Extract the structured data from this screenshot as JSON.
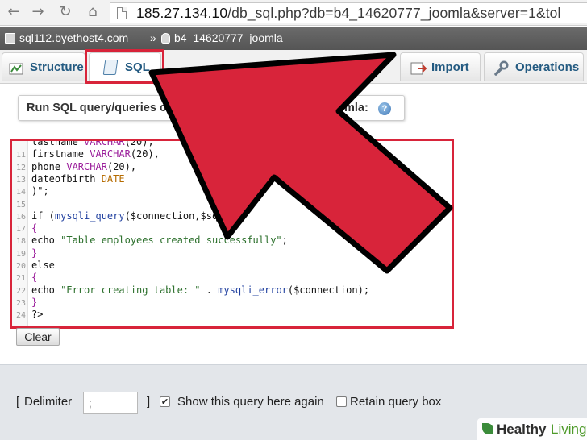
{
  "browser": {
    "url_host": "185.27.134.10",
    "url_path": "/db_sql.php?db=b4_14620777_joomla&server=1&tol"
  },
  "breadcrumb": {
    "server": "sql112.byethost4.com",
    "separator": "»",
    "database": "b4_14620777_joomla"
  },
  "tabs": [
    {
      "label": "Structure",
      "icon": "structure-icon"
    },
    {
      "label": "SQL",
      "icon": "sql-icon",
      "active": true
    },
    {
      "label": "Import",
      "icon": "import-icon"
    },
    {
      "label": "Operations",
      "icon": "wrench-icon"
    }
  ],
  "query_box": {
    "legend_left": "Run SQL query/queries on",
    "legend_right": "mla:",
    "help_icon": "help-icon",
    "code_lines": [
      {
        "n": "",
        "text": "lastname VARCHAR(20),"
      },
      {
        "n": "11",
        "text": "firstname VARCHAR(20),"
      },
      {
        "n": "12",
        "text": "phone VARCHAR(20),"
      },
      {
        "n": "13",
        "text": "dateofbirth DATE"
      },
      {
        "n": "14",
        "text": ")\";"
      },
      {
        "n": "15",
        "text": ""
      },
      {
        "n": "16",
        "text": "if (mysqli_query($connection,$sql))"
      },
      {
        "n": "17",
        "text": "{"
      },
      {
        "n": "18",
        "text": "echo \"Table employees created successfully\";"
      },
      {
        "n": "19",
        "text": "}"
      },
      {
        "n": "20",
        "text": "else"
      },
      {
        "n": "21",
        "text": "{"
      },
      {
        "n": "22",
        "text": "echo \"Error creating table: \" . mysqli_error($connection);"
      },
      {
        "n": "23",
        "text": "}"
      },
      {
        "n": "24",
        "text": "?>"
      }
    ],
    "clear_label": "Clear"
  },
  "options": {
    "open_bracket": "[",
    "delimiter_label": "Delimiter",
    "delimiter_value": ";",
    "close_bracket": "]",
    "show_query_label": "Show this query here again",
    "show_query_checked": true,
    "retain_label": "Retain query box",
    "retain_checked": false
  },
  "watermark": {
    "part1": "Healthy",
    "part2": "Living"
  },
  "colors": {
    "highlight": "#d8243a",
    "arrow_fill": "#d8243a",
    "arrow_outline": "#000000",
    "tab_text": "#235a81"
  }
}
